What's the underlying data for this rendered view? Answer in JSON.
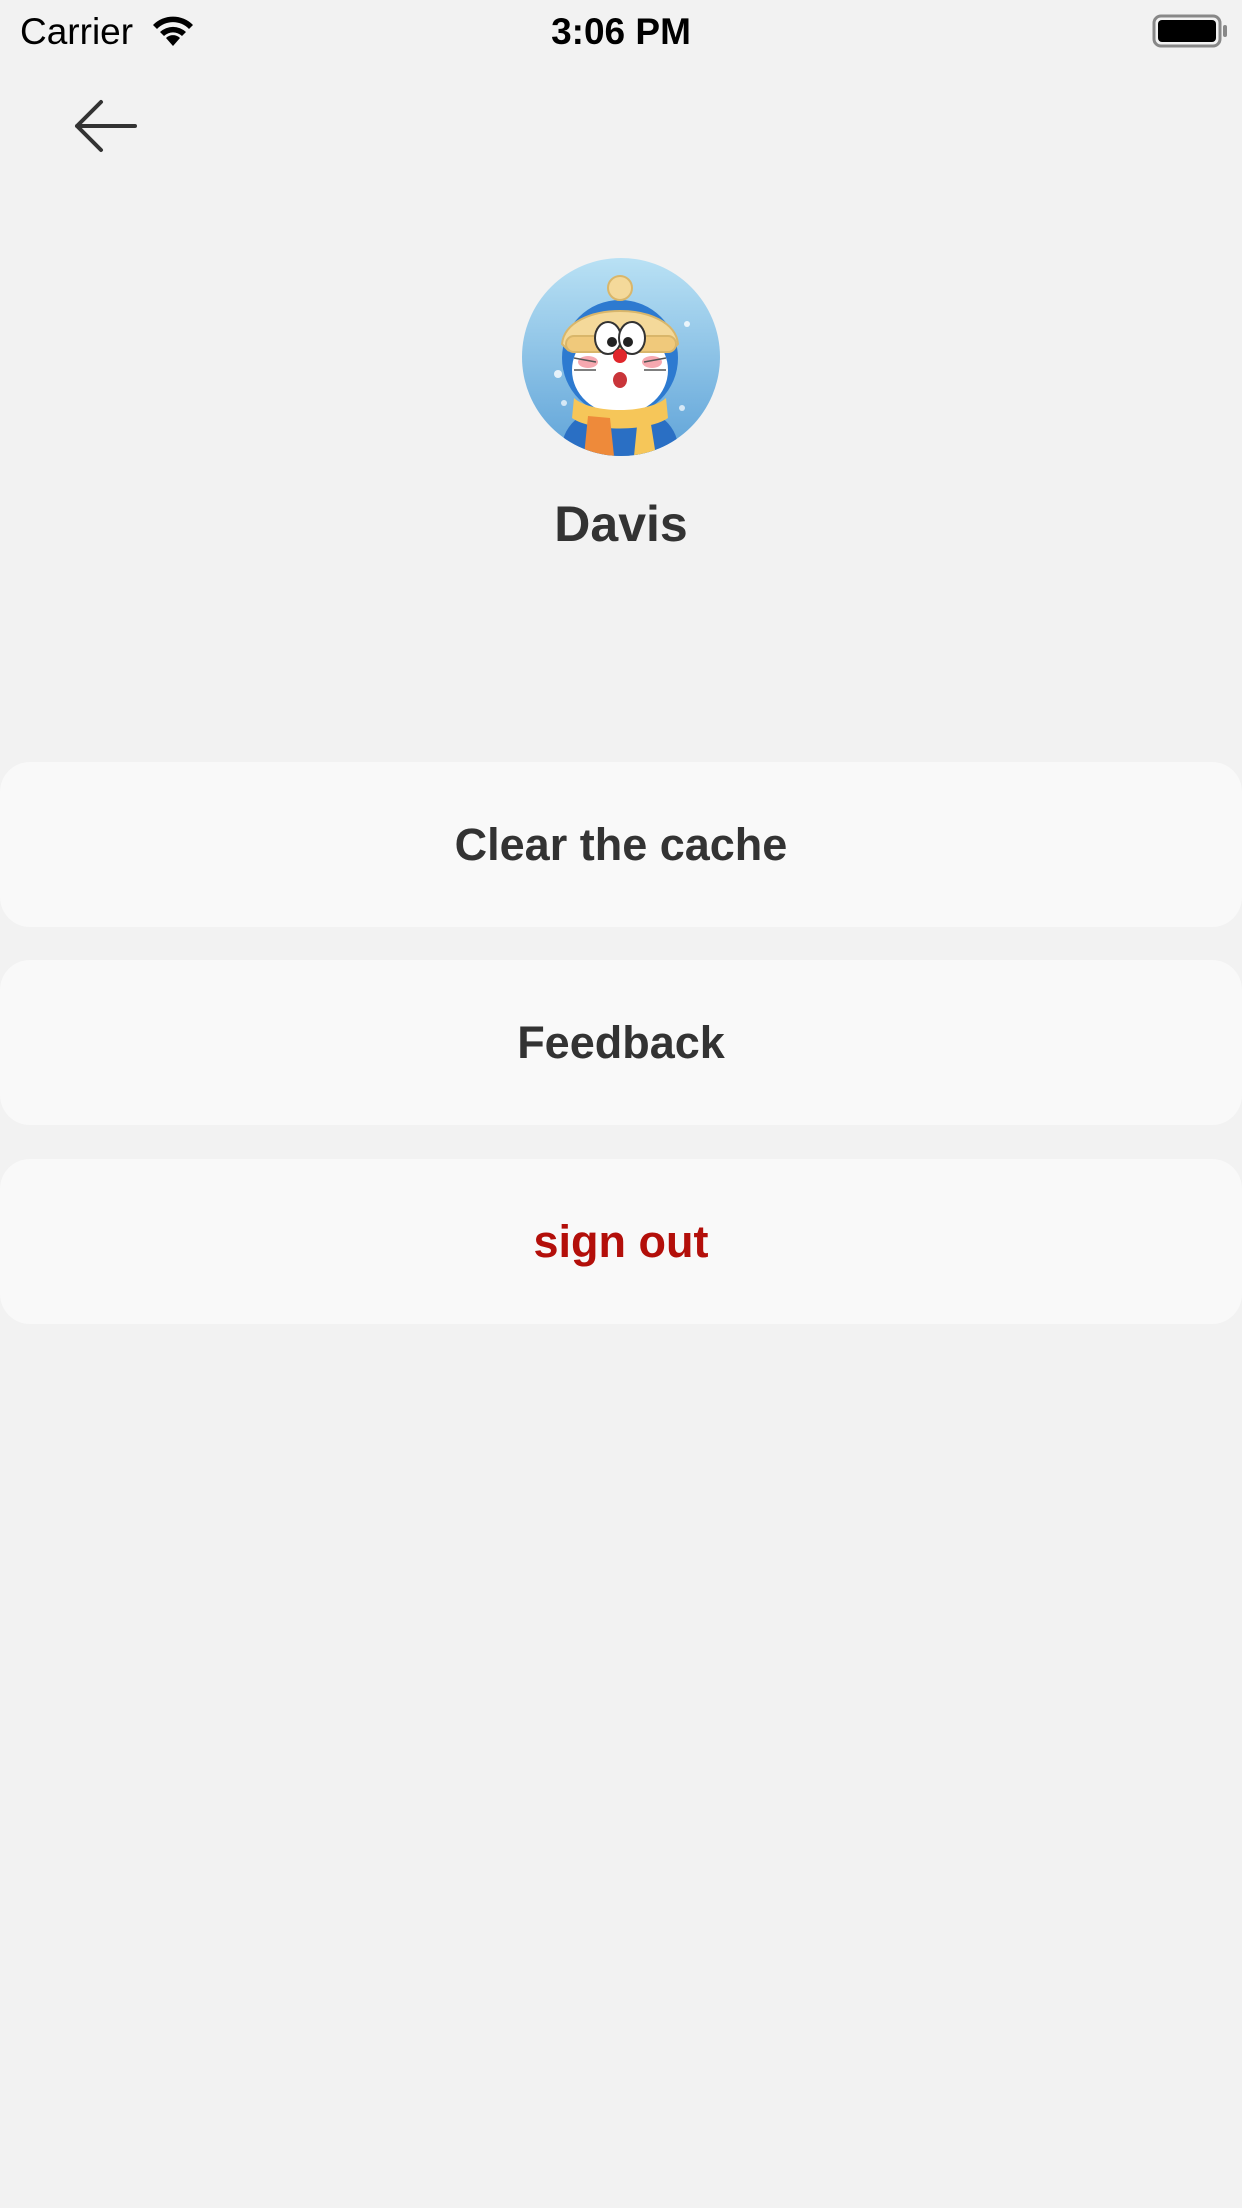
{
  "status_bar": {
    "carrier": "Carrier",
    "time": "3:06 PM",
    "icons": [
      "wifi-icon",
      "battery-icon"
    ]
  },
  "nav": {
    "back_icon": "back-arrow-icon"
  },
  "profile": {
    "name": "Davis",
    "avatar_icon": "avatar-image"
  },
  "actions": [
    {
      "label": "Clear the cache"
    },
    {
      "label": "Feedback"
    },
    {
      "label": "sign out"
    }
  ],
  "colors": {
    "background": "#f2f2f2",
    "button_background": "#f9f9f9",
    "text": "#333333",
    "destructive": "#b30f0a"
  }
}
